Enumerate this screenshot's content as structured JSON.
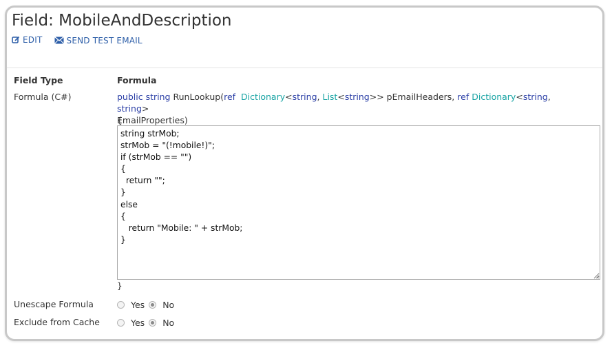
{
  "page": {
    "title": "Field: MobileAndDescription"
  },
  "actions": {
    "edit": "EDIT",
    "send_test_email": "SEND TEST EMAIL"
  },
  "table": {
    "header_left": "Field Type",
    "header_right": "Formula"
  },
  "formula": {
    "label": "Formula (C#)",
    "sig": {
      "public": "public",
      "string": "string",
      "method": "RunLookup(",
      "ref1": "ref",
      "dict1": "Dictionary",
      "lt1": "<",
      "string2": "string",
      "comma1": ",",
      "list": "List",
      "lt2": "<",
      "string3": "string",
      "gt2": ">>",
      "param1": "pEmailHeaders,",
      "ref2": "ref",
      "dict2": "Dictionary",
      "lt3": "<",
      "string4": "string",
      "comma2": ",",
      "string5": "string",
      "gt3": ">",
      "param2": "EmailProperties)"
    },
    "open_brace": "{",
    "close_brace": "}",
    "code": "string strMob;\nstrMob = \"(!mobile!)\";\nif (strMob == \"\")\n{\n  return \"\";\n}\nelse\n{\n   return \"Mobile: \" + strMob;\n}"
  },
  "unescape": {
    "label": "Unescape Formula",
    "yes": "Yes",
    "no": "No",
    "selected": "No"
  },
  "exclude_cache": {
    "label": "Exclude from Cache",
    "yes": "Yes",
    "no": "No",
    "selected": "No"
  },
  "colors": {
    "link": "#2d5ea8",
    "keyword": "#2b3fa6",
    "type": "#17a3a3"
  }
}
